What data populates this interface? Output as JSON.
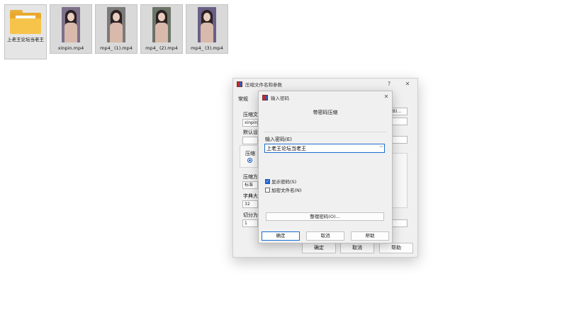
{
  "files": [
    {
      "name": "上老王论坛当老王",
      "type": "folder"
    },
    {
      "name": "xinpin.mp4",
      "type": "video",
      "thumb_bg": "#7e6f8a"
    },
    {
      "name": "mp4_ (1).mp4",
      "type": "video",
      "thumb_bg": "#7c7a78"
    },
    {
      "name": "mp4_ (2).mp4",
      "type": "video",
      "thumb_bg": "#6b7466"
    },
    {
      "name": "mp4_ (3).mp4",
      "type": "video",
      "thumb_bg": "#6a5f86"
    }
  ],
  "back_dialog": {
    "title": "压缩文件名和参数",
    "help_glyph": "?",
    "close_glyph": "✕",
    "tab_general": "常规",
    "archive_name_label": "压缩文",
    "archive_name_value": "xinpin",
    "browse_label": "B)...",
    "profile_label": "默认设",
    "format_label": "压缩",
    "method_label": "压缩方",
    "method_value": "标准",
    "dict_label": "字典大",
    "dict_value": "32",
    "split_label": "切分为",
    "split_value": "1",
    "ok_label": "确定",
    "cancel_label": "取消",
    "help_label": "帮助"
  },
  "password_dialog": {
    "title": "输入密码",
    "close_glyph": "✕",
    "heading": "带密码压缩",
    "password_label": "输入密码(E)",
    "password_value": "上老王论坛当老王",
    "show_password_label": "显示密码(S)",
    "show_password_checked": true,
    "encrypt_names_label": "加密文件名(N)",
    "encrypt_names_checked": false,
    "organize_button_label": "整理密码(O)...",
    "ok_label": "确定",
    "cancel_label": "取消",
    "help_label": "帮助"
  },
  "colors": {
    "accent": "#1a6fcf",
    "folder": "#f6c44a",
    "tile_selected": "#d9d9d9",
    "dialog_bg": "#f0f0f0"
  }
}
